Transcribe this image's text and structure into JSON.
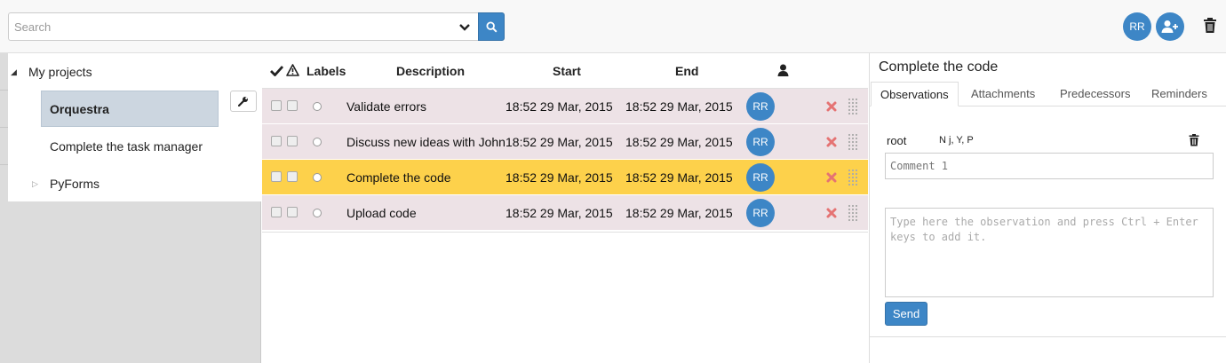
{
  "search": {
    "placeholder": "Search"
  },
  "header": {
    "avatar_initials": "RR",
    "add_user_icon": "user-plus-icon",
    "trash_icon": "trash-icon"
  },
  "tree": {
    "root": {
      "label": "My projects",
      "expanded": true
    },
    "items": [
      {
        "label": "Orquestra",
        "selected": true
      },
      {
        "label": "Complete the task manager"
      },
      {
        "label": "PyForms",
        "expandable": true
      }
    ]
  },
  "table": {
    "headers": {
      "labels": "Labels",
      "description": "Description",
      "start": "Start",
      "end": "End",
      "user_icon": "user-icon"
    },
    "rows": [
      {
        "description": "Validate errors",
        "start": "18:52 29 Mar, 2015",
        "end": "18:52 29 Mar, 2015",
        "user": "RR",
        "active": false
      },
      {
        "description": "Discuss new ideas with John",
        "start": "18:52 29 Mar, 2015",
        "end": "18:52 29 Mar, 2015",
        "user": "RR",
        "active": false
      },
      {
        "description": "Complete the code",
        "start": "18:52 29 Mar, 2015",
        "end": "18:52 29 Mar, 2015",
        "user": "RR",
        "active": true
      },
      {
        "description": "Upload code",
        "start": "18:52 29 Mar, 2015",
        "end": "18:52 29 Mar, 2015",
        "user": "RR",
        "active": false
      }
    ]
  },
  "detail": {
    "title": "Complete the code",
    "tabs": [
      "Observations",
      "Attachments",
      "Predecessors",
      "Reminders"
    ],
    "active_tab": "Observations",
    "observation": {
      "user": "root",
      "meta": "N j, Y, P",
      "comment": "Comment 1"
    },
    "new_observation_placeholder": "Type here the observation and press Ctrl + Enter keys to add it.",
    "send_label": "Send"
  },
  "colors": {
    "accent": "#3d86c6",
    "row_bg": "#ede2e6",
    "row_active": "#fdd14b",
    "delete": "#e57373"
  }
}
